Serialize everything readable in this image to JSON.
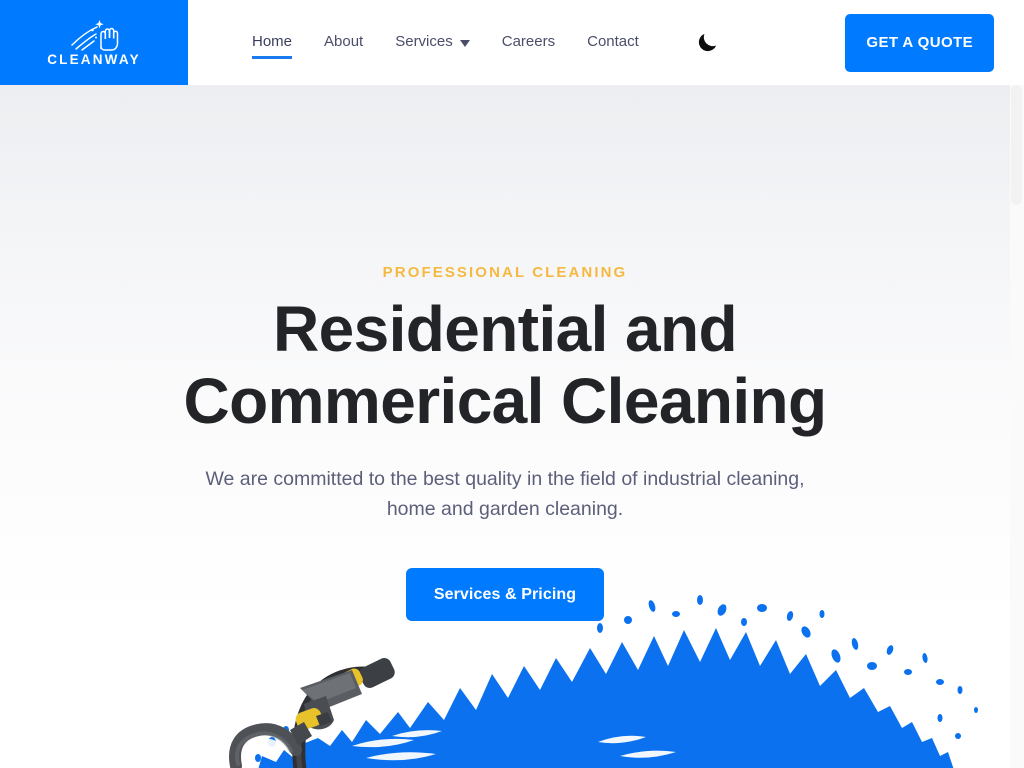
{
  "brand": {
    "name": "CLEANWAY",
    "logo_icon": "cleaning-hand-sparkle-icon",
    "block_color": "#007bff"
  },
  "header": {
    "nav": [
      {
        "label": "Home",
        "active": true,
        "has_dropdown": false,
        "name": "nav-item-home"
      },
      {
        "label": "About",
        "active": false,
        "has_dropdown": false,
        "name": "nav-item-about"
      },
      {
        "label": "Services",
        "active": false,
        "has_dropdown": true,
        "name": "nav-item-services"
      },
      {
        "label": "Careers",
        "active": false,
        "has_dropdown": false,
        "name": "nav-item-careers"
      },
      {
        "label": "Contact",
        "active": false,
        "has_dropdown": false,
        "name": "nav-item-contact"
      }
    ],
    "theme_toggle_icon": "moon-icon",
    "quote_button_label": "GET A QUOTE"
  },
  "hero": {
    "eyebrow": "PROFESSIONAL CLEANING",
    "title_line1": "Residential and",
    "title_line2": "Commerical Cleaning",
    "subtitle": "We are committed to the best quality in the field of industrial cleaning, home and garden cleaning.",
    "cta_label": "Services & Pricing",
    "artwork": "pressure-washer-with-blue-paint-splash"
  },
  "colors": {
    "accent_blue": "#007bff",
    "eyebrow_amber": "#f5b942",
    "heading_dark": "#222428",
    "body_gray": "#5c5f7a",
    "nav_gray": "#4a4e69"
  }
}
